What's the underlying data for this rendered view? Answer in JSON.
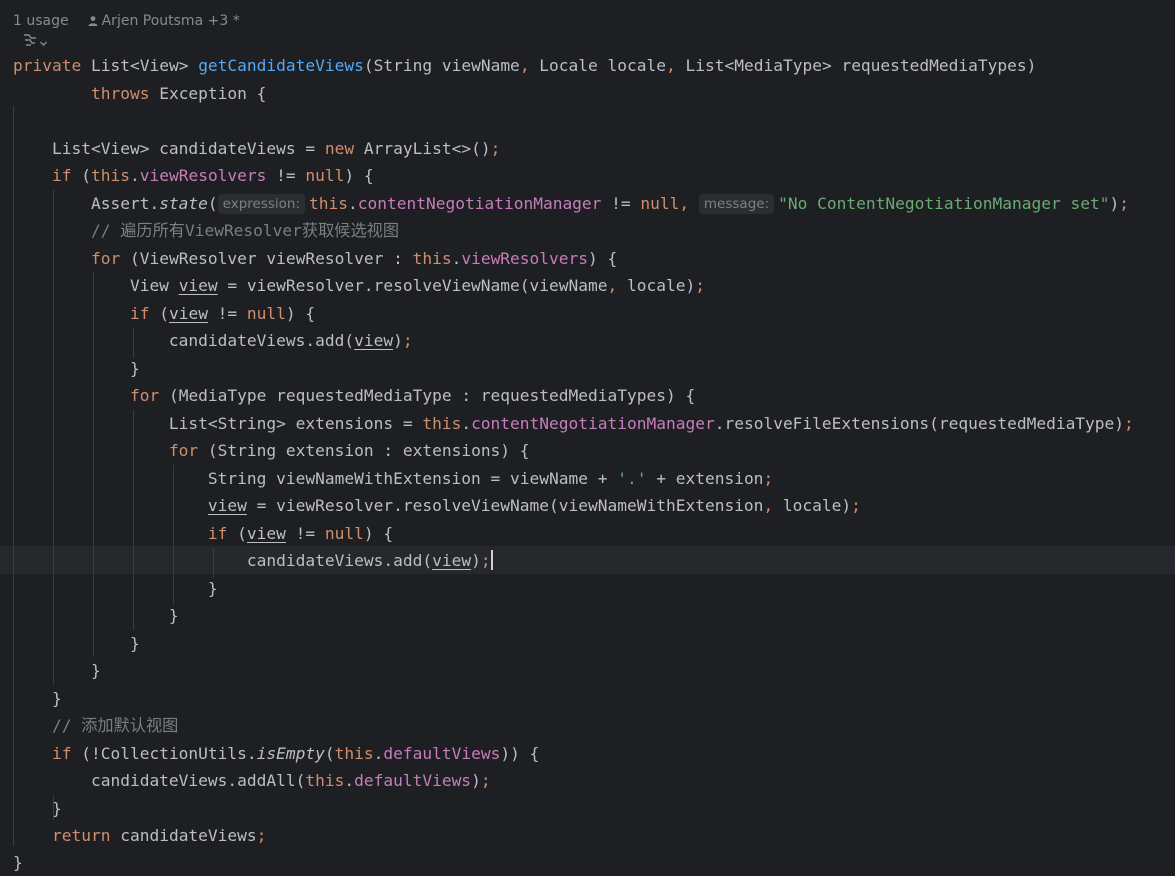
{
  "code_lens": {
    "usages": "1 usage",
    "authors": "Arjen Poutsma +3 *"
  },
  "icons": {
    "author": "person-icon",
    "ai_assist": "ai-sparkle-icon",
    "chevron": "chevron-down-icon"
  },
  "colors": {
    "background": "#1e1f22",
    "keyword": "#cf8e6d",
    "method": "#56a8f5",
    "field": "#c77dbb",
    "string": "#6aab73",
    "comment": "#7a7e85",
    "text": "#bcbec4"
  },
  "code": {
    "l1": {
      "t1": "private",
      "t2": " List<View> ",
      "t3": "getCandidateViews",
      "t4": "(String viewName",
      "t5": ",",
      "t6": " Locale locale",
      "t7": ",",
      "t8": " List<MediaType> requestedMediaTypes)"
    },
    "l2": {
      "t1": "        ",
      "t2": "throws",
      "t3": " Exception {"
    },
    "l4": {
      "t1": "    List<View> candidateViews = ",
      "t2": "new",
      "t3": " ArrayList<>()",
      "t4": ";"
    },
    "l5": {
      "t1": "    ",
      "t2": "if",
      "t3": " (",
      "t4": "this",
      "t5": ".",
      "t6": "viewResolvers",
      "t7": " != ",
      "t8": "null",
      "t9": ") {"
    },
    "l6": {
      "t1": "        Assert.",
      "t2": "state",
      "t3": "(",
      "h1": "expression:",
      "t4": "this",
      "t5": ".",
      "t6": "contentNegotiationManager",
      "t7": " != ",
      "t8": "null",
      "t9": ",",
      "t10": " ",
      "h2": "message:",
      "t11": "\"No ContentNegotiationManager set\"",
      "t12": ")",
      "t13": ";"
    },
    "l7": {
      "t1": "        ",
      "t2": "// 遍历所有ViewResolver获取候选视图"
    },
    "l8": {
      "t1": "        ",
      "t2": "for",
      "t3": " (ViewResolver viewResolver : ",
      "t4": "this",
      "t5": ".",
      "t6": "viewResolvers",
      "t7": ") {"
    },
    "l9": {
      "t1": "            View ",
      "t2": "view",
      "t3": " = viewResolver.resolveViewName(viewName",
      "t4": ",",
      "t5": " locale)",
      "t6": ";"
    },
    "l10": {
      "t1": "            ",
      "t2": "if",
      "t3": " (",
      "t4": "view",
      "t5": " != ",
      "t6": "null",
      "t7": ") {"
    },
    "l11": {
      "t1": "                candidateViews.add(",
      "t2": "view",
      "t3": ")",
      "t4": ";"
    },
    "l12": {
      "t1": "            }"
    },
    "l13": {
      "t1": "            ",
      "t2": "for",
      "t3": " (MediaType requestedMediaType : requestedMediaTypes) {"
    },
    "l14": {
      "t1": "                List<String> extensions = ",
      "t2": "this",
      "t3": ".",
      "t4": "contentNegotiationManager",
      "t5": ".resolveFileExtensions(requestedMediaType)",
      "t6": ";"
    },
    "l15": {
      "t1": "                ",
      "t2": "for",
      "t3": " (String extension : extensions) {"
    },
    "l16": {
      "t1": "                    String viewNameWithExtension = viewName + ",
      "t2": "'.'",
      "t3": " + extension",
      "t4": ";"
    },
    "l17": {
      "t1": "                    ",
      "t2": "view",
      "t3": " = viewResolver.resolveViewName(viewNameWithExtension",
      "t4": ",",
      "t5": " locale)",
      "t6": ";"
    },
    "l18": {
      "t1": "                    ",
      "t2": "if",
      "t3": " (",
      "t4": "view",
      "t5": " != ",
      "t6": "null",
      "t7": ") {"
    },
    "l19": {
      "t1": "                        candidateViews.add(",
      "t2": "view",
      "t3": ")",
      "t4": ";"
    },
    "l20": {
      "t1": "                    }"
    },
    "l21": {
      "t1": "                }"
    },
    "l22": {
      "t1": "            }"
    },
    "l23": {
      "t1": "        }"
    },
    "l24": {
      "t1": "    }"
    },
    "l25": {
      "t1": "    ",
      "t2": "// 添加默认视图"
    },
    "l26": {
      "t1": "    ",
      "t2": "if",
      "t3": " (!CollectionUtils.",
      "t4": "isEmpty",
      "t5": "(",
      "t6": "this",
      "t7": ".",
      "t8": "defaultViews",
      "t9": ")) {"
    },
    "l27": {
      "t1": "        candidateViews.addAll(",
      "t2": "this",
      "t3": ".",
      "t4": "defaultViews",
      "t5": ")",
      "t6": ";"
    },
    "l28": {
      "t1": "    }"
    },
    "l29": {
      "t1": "    ",
      "t2": "return",
      "t3": " candidateViews",
      "t4": ";"
    },
    "l30": {
      "t1": "}"
    }
  }
}
